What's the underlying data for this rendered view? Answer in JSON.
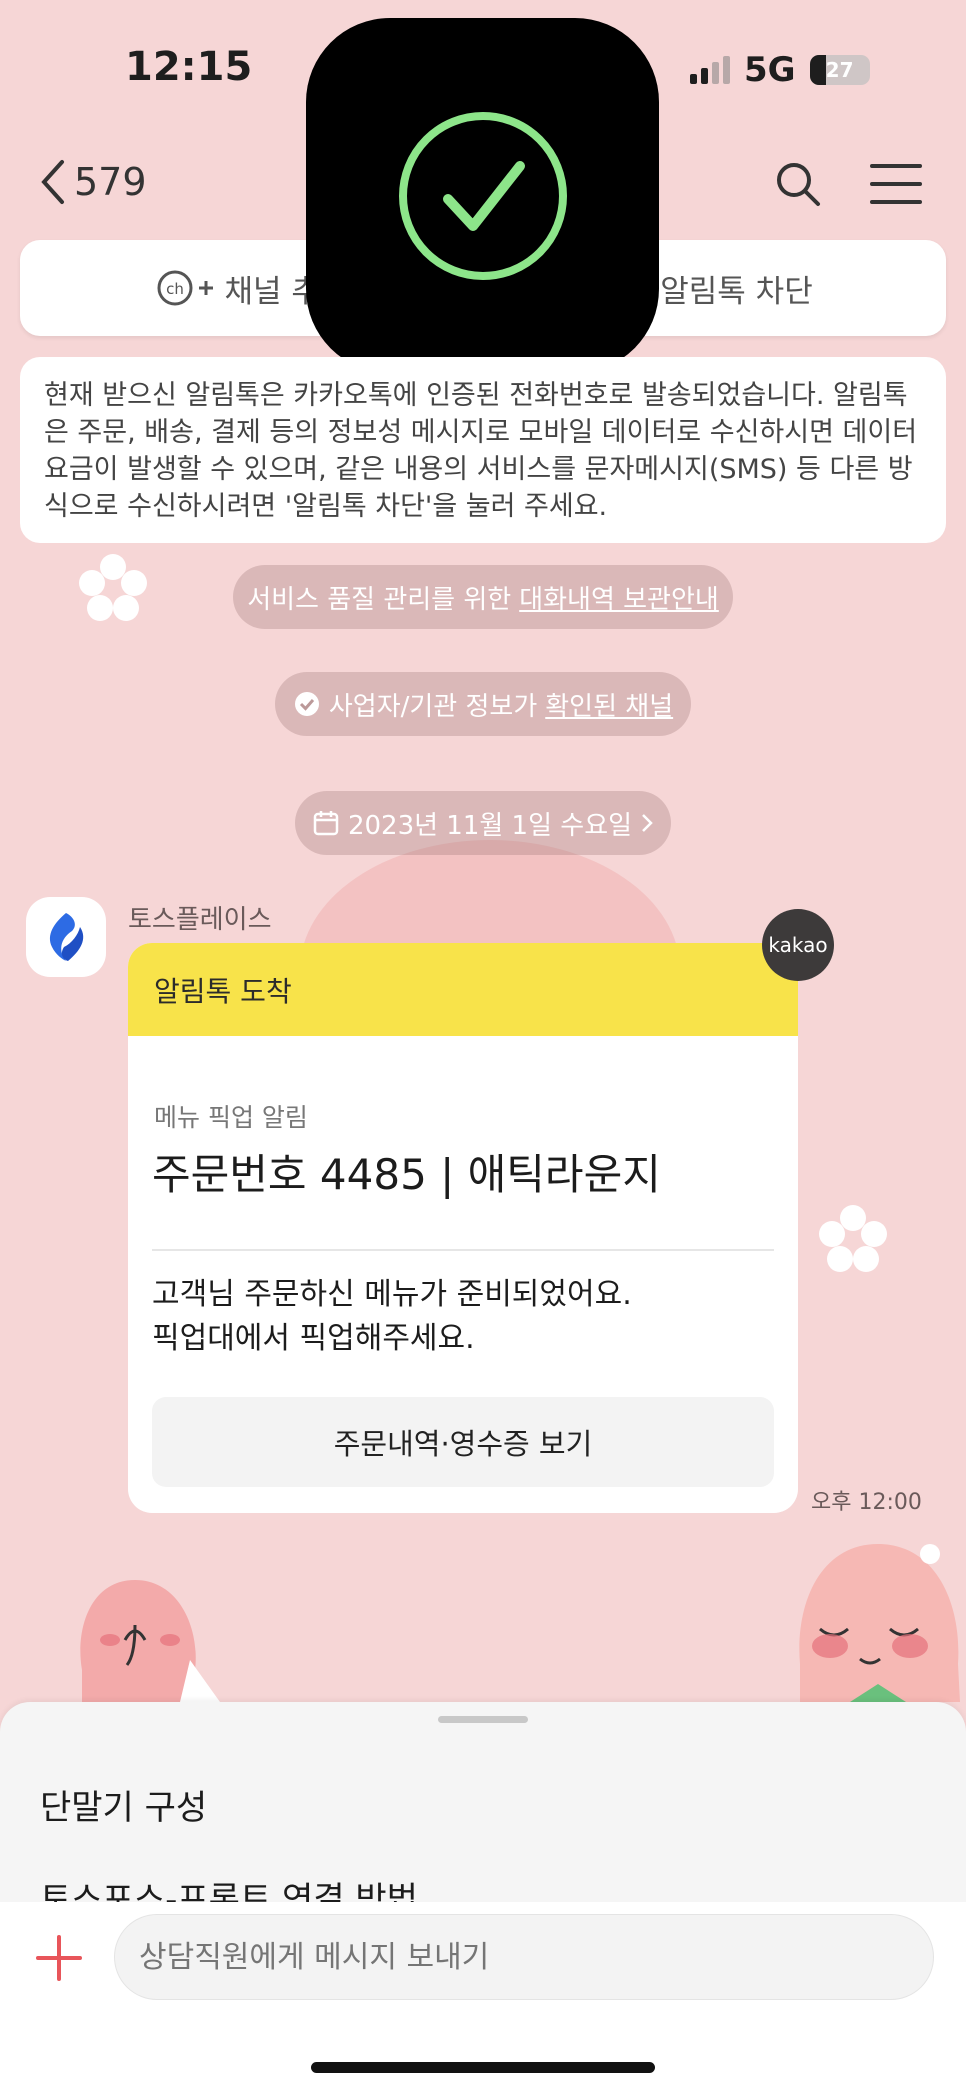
{
  "status_bar": {
    "time": "12:15",
    "network": "5G",
    "battery": "27"
  },
  "header": {
    "back_count": "579"
  },
  "top_buttons": {
    "add_channel": "채널 추가",
    "block": "알림톡 차단"
  },
  "notice": "현재 받으신 알림톡은 카카오톡에 인증된 전화번호로 발송되었습니다. 알림톡은 주문, 배송, 결제 등의 정보성 메시지로 모바일 데이터로 수신하시면 데이터 요금이 발생할 수 있으며, 같은 내용의 서비스를 문자메시지(SMS) 등 다른 방식으로 수신하시려면 '알림톡 차단'을 눌러 주세요.",
  "pills": {
    "service_prefix": "서비스 품질 관리를 위한 ",
    "service_link": "대화내역 보관안내",
    "verified_prefix": "사업자/기관 정보가 ",
    "verified_link": "확인된 채널",
    "date": "2023년 11월 1일 수요일"
  },
  "message": {
    "sender": "토스플레이스",
    "badge": "kakao",
    "header": "알림톡 도착",
    "subtitle": "메뉴 픽업 알림",
    "title": "주문번호 4485 | 애틱라운지",
    "body_line1": "고객님 주문하신 메뉴가 준비되었어요.",
    "body_line2": "픽업대에서 픽업해주세요.",
    "button": "주문내역·영수증 보기",
    "time": "오후 12:00"
  },
  "sheet": {
    "items": [
      "단말기 구성",
      "토스포스-프론트 연결 방법"
    ]
  },
  "input": {
    "placeholder": "상담직원에게 메시지 보내기"
  },
  "colors": {
    "background": "#f6d6d6",
    "alimtalk_header": "#f8e34a",
    "plus": "#e8555a",
    "check": "#8de58a"
  }
}
